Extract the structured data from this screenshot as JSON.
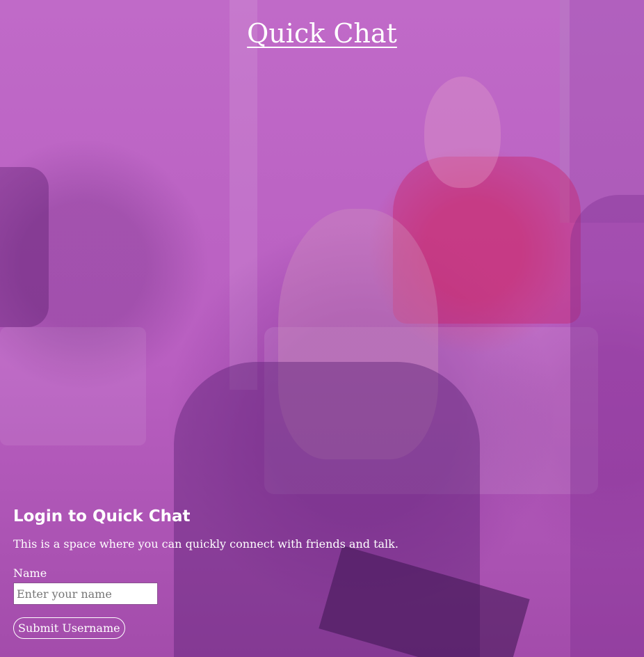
{
  "header": {
    "title": "Quick Chat"
  },
  "login": {
    "heading": "Login to Quick Chat",
    "description": "This is a space where you can quickly connect with friends and talk.",
    "name_label": "Name",
    "name_placeholder": "Enter your name",
    "name_value": "",
    "submit_label": "Submit Username"
  },
  "colors": {
    "overlay_tint": "#b95fc1",
    "text": "#ffffff"
  }
}
